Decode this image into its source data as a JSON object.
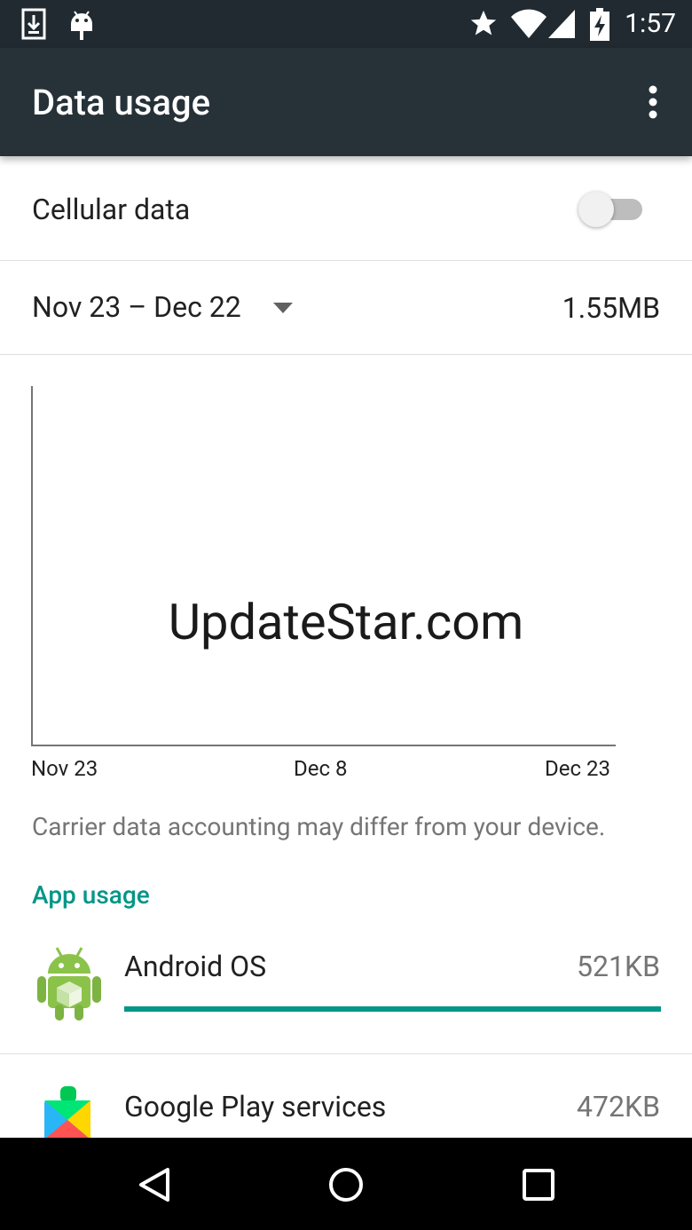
{
  "status_bar": {
    "time": "1:57",
    "icons": [
      "download-notification-icon",
      "android-debug-icon",
      "star-icon",
      "wifi-icon",
      "cell-signal-icon",
      "battery-charging-icon"
    ]
  },
  "app_bar": {
    "title": "Data usage",
    "overflow_icon": "more-vert-icon"
  },
  "cellular": {
    "label": "Cellular data",
    "enabled": false
  },
  "cycle": {
    "range": "Nov 23 – Dec 22",
    "total": "1.55MB"
  },
  "chart_data": {
    "type": "line",
    "x_ticks": [
      "Nov 23",
      "Dec 8",
      "Dec 23"
    ],
    "series": [],
    "watermark": "UpdateStar.com"
  },
  "note": "Carrier data accounting may differ from your device.",
  "app_usage": {
    "header": "App usage",
    "apps": [
      {
        "name": "Android OS",
        "size": "521KB",
        "icon": "android-os-icon",
        "fraction": 1.0
      },
      {
        "name": "Google Play services",
        "size": "472KB",
        "icon": "google-play-services-icon"
      }
    ]
  },
  "colors": {
    "accent": "#009688",
    "app_bar": "#263238",
    "status_bar": "#202a30"
  },
  "nav_bar": {
    "buttons": [
      "back-icon",
      "home-icon",
      "recents-icon"
    ]
  }
}
